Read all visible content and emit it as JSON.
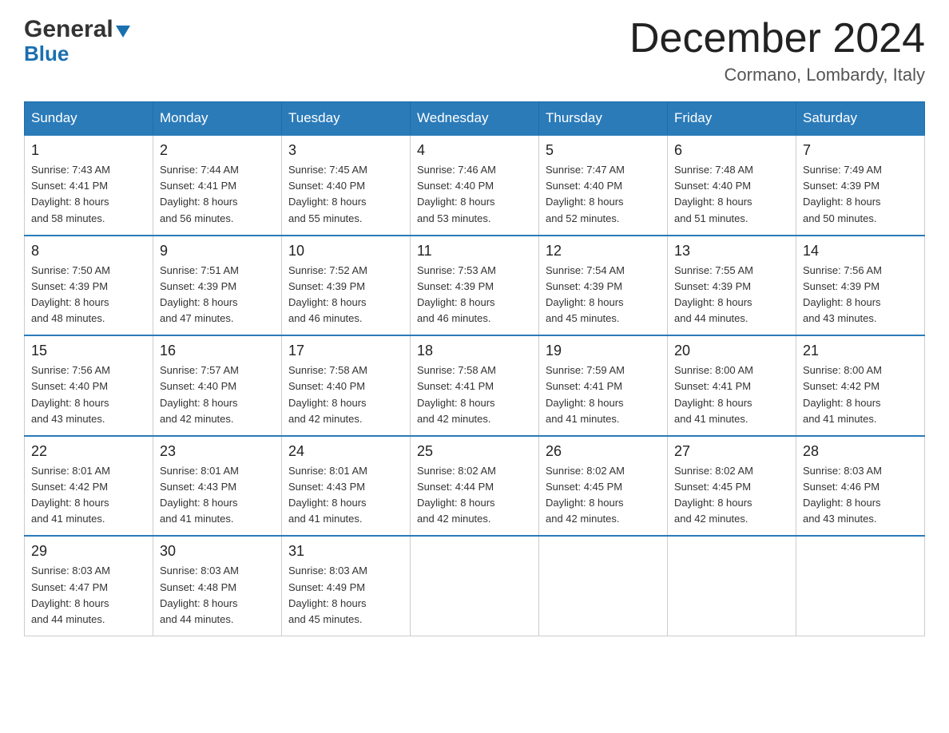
{
  "header": {
    "logo_general": "General",
    "logo_blue": "Blue",
    "month_title": "December 2024",
    "location": "Cormano, Lombardy, Italy"
  },
  "weekdays": [
    "Sunday",
    "Monday",
    "Tuesday",
    "Wednesday",
    "Thursday",
    "Friday",
    "Saturday"
  ],
  "weeks": [
    [
      {
        "day": "1",
        "sunrise": "7:43 AM",
        "sunset": "4:41 PM",
        "daylight": "8 hours and 58 minutes."
      },
      {
        "day": "2",
        "sunrise": "7:44 AM",
        "sunset": "4:41 PM",
        "daylight": "8 hours and 56 minutes."
      },
      {
        "day": "3",
        "sunrise": "7:45 AM",
        "sunset": "4:40 PM",
        "daylight": "8 hours and 55 minutes."
      },
      {
        "day": "4",
        "sunrise": "7:46 AM",
        "sunset": "4:40 PM",
        "daylight": "8 hours and 53 minutes."
      },
      {
        "day": "5",
        "sunrise": "7:47 AM",
        "sunset": "4:40 PM",
        "daylight": "8 hours and 52 minutes."
      },
      {
        "day": "6",
        "sunrise": "7:48 AM",
        "sunset": "4:40 PM",
        "daylight": "8 hours and 51 minutes."
      },
      {
        "day": "7",
        "sunrise": "7:49 AM",
        "sunset": "4:39 PM",
        "daylight": "8 hours and 50 minutes."
      }
    ],
    [
      {
        "day": "8",
        "sunrise": "7:50 AM",
        "sunset": "4:39 PM",
        "daylight": "8 hours and 48 minutes."
      },
      {
        "day": "9",
        "sunrise": "7:51 AM",
        "sunset": "4:39 PM",
        "daylight": "8 hours and 47 minutes."
      },
      {
        "day": "10",
        "sunrise": "7:52 AM",
        "sunset": "4:39 PM",
        "daylight": "8 hours and 46 minutes."
      },
      {
        "day": "11",
        "sunrise": "7:53 AM",
        "sunset": "4:39 PM",
        "daylight": "8 hours and 46 minutes."
      },
      {
        "day": "12",
        "sunrise": "7:54 AM",
        "sunset": "4:39 PM",
        "daylight": "8 hours and 45 minutes."
      },
      {
        "day": "13",
        "sunrise": "7:55 AM",
        "sunset": "4:39 PM",
        "daylight": "8 hours and 44 minutes."
      },
      {
        "day": "14",
        "sunrise": "7:56 AM",
        "sunset": "4:39 PM",
        "daylight": "8 hours and 43 minutes."
      }
    ],
    [
      {
        "day": "15",
        "sunrise": "7:56 AM",
        "sunset": "4:40 PM",
        "daylight": "8 hours and 43 minutes."
      },
      {
        "day": "16",
        "sunrise": "7:57 AM",
        "sunset": "4:40 PM",
        "daylight": "8 hours and 42 minutes."
      },
      {
        "day": "17",
        "sunrise": "7:58 AM",
        "sunset": "4:40 PM",
        "daylight": "8 hours and 42 minutes."
      },
      {
        "day": "18",
        "sunrise": "7:58 AM",
        "sunset": "4:41 PM",
        "daylight": "8 hours and 42 minutes."
      },
      {
        "day": "19",
        "sunrise": "7:59 AM",
        "sunset": "4:41 PM",
        "daylight": "8 hours and 41 minutes."
      },
      {
        "day": "20",
        "sunrise": "8:00 AM",
        "sunset": "4:41 PM",
        "daylight": "8 hours and 41 minutes."
      },
      {
        "day": "21",
        "sunrise": "8:00 AM",
        "sunset": "4:42 PM",
        "daylight": "8 hours and 41 minutes."
      }
    ],
    [
      {
        "day": "22",
        "sunrise": "8:01 AM",
        "sunset": "4:42 PM",
        "daylight": "8 hours and 41 minutes."
      },
      {
        "day": "23",
        "sunrise": "8:01 AM",
        "sunset": "4:43 PM",
        "daylight": "8 hours and 41 minutes."
      },
      {
        "day": "24",
        "sunrise": "8:01 AM",
        "sunset": "4:43 PM",
        "daylight": "8 hours and 41 minutes."
      },
      {
        "day": "25",
        "sunrise": "8:02 AM",
        "sunset": "4:44 PM",
        "daylight": "8 hours and 42 minutes."
      },
      {
        "day": "26",
        "sunrise": "8:02 AM",
        "sunset": "4:45 PM",
        "daylight": "8 hours and 42 minutes."
      },
      {
        "day": "27",
        "sunrise": "8:02 AM",
        "sunset": "4:45 PM",
        "daylight": "8 hours and 42 minutes."
      },
      {
        "day": "28",
        "sunrise": "8:03 AM",
        "sunset": "4:46 PM",
        "daylight": "8 hours and 43 minutes."
      }
    ],
    [
      {
        "day": "29",
        "sunrise": "8:03 AM",
        "sunset": "4:47 PM",
        "daylight": "8 hours and 44 minutes."
      },
      {
        "day": "30",
        "sunrise": "8:03 AM",
        "sunset": "4:48 PM",
        "daylight": "8 hours and 44 minutes."
      },
      {
        "day": "31",
        "sunrise": "8:03 AM",
        "sunset": "4:49 PM",
        "daylight": "8 hours and 45 minutes."
      },
      null,
      null,
      null,
      null
    ]
  ],
  "labels": {
    "sunrise": "Sunrise:",
    "sunset": "Sunset:",
    "daylight": "Daylight:"
  }
}
